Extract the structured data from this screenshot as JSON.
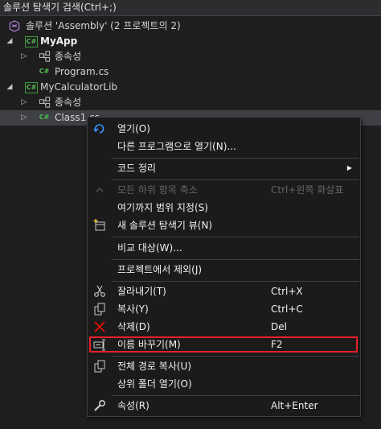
{
  "search": {
    "label": "솔루션 탐색기 검색(Ctrl+;)"
  },
  "tree": {
    "solution": {
      "label": "솔루션 'Assembly'  (2 프로젝트의 2)"
    },
    "projects": [
      {
        "name": "MyApp",
        "deps": "종속성",
        "file": "Program.cs",
        "file_badge": "C#",
        "badge": "C#"
      },
      {
        "name": "MyCalculatorLib",
        "deps": "종속성",
        "file": "Class1.cs",
        "file_badge": "C#",
        "badge": "C#"
      }
    ]
  },
  "menu": {
    "items": [
      {
        "label": "열기(O)",
        "shortcut": "",
        "icon": "open-icon"
      },
      {
        "label": "다른 프로그램으로 열기(N)...",
        "shortcut": ""
      },
      {
        "label": "코드 정리",
        "shortcut": "",
        "submenu": true
      },
      {
        "label": "모든 하위 항목 축소",
        "shortcut": "Ctrl+왼쪽 화살표",
        "disabled": true,
        "icon": "collapse-icon"
      },
      {
        "label": "여기까지 범위 지정(S)",
        "shortcut": ""
      },
      {
        "label": "새 솔루션 탐색기 뷰(N)",
        "shortcut": "",
        "icon": "new-view-icon"
      },
      {
        "label": "비교 대상(W)...",
        "shortcut": ""
      },
      {
        "label": "프로젝트에서 제외(J)",
        "shortcut": ""
      },
      {
        "label": "잘라내기(T)",
        "shortcut": "Ctrl+X",
        "icon": "scissors-icon"
      },
      {
        "label": "복사(Y)",
        "shortcut": "Ctrl+C",
        "icon": "copy-icon"
      },
      {
        "label": "삭제(D)",
        "shortcut": "Del",
        "icon": "delete-icon"
      },
      {
        "label": "이름 바꾸기(M)",
        "shortcut": "F2",
        "icon": "rename-icon",
        "highlighted": true
      },
      {
        "label": "전체 경로 복사(U)",
        "shortcut": "",
        "icon": "copy-path-icon"
      },
      {
        "label": "상위 폴더 열기(O)",
        "shortcut": ""
      },
      {
        "label": "속성(R)",
        "shortcut": "Alt+Enter",
        "icon": "wrench-icon"
      }
    ]
  },
  "colors": {
    "background": "#1e1e1e",
    "menu_bg": "#1b1b1c",
    "highlight_border": "#e8202a",
    "csharp_green": "#55b955"
  }
}
